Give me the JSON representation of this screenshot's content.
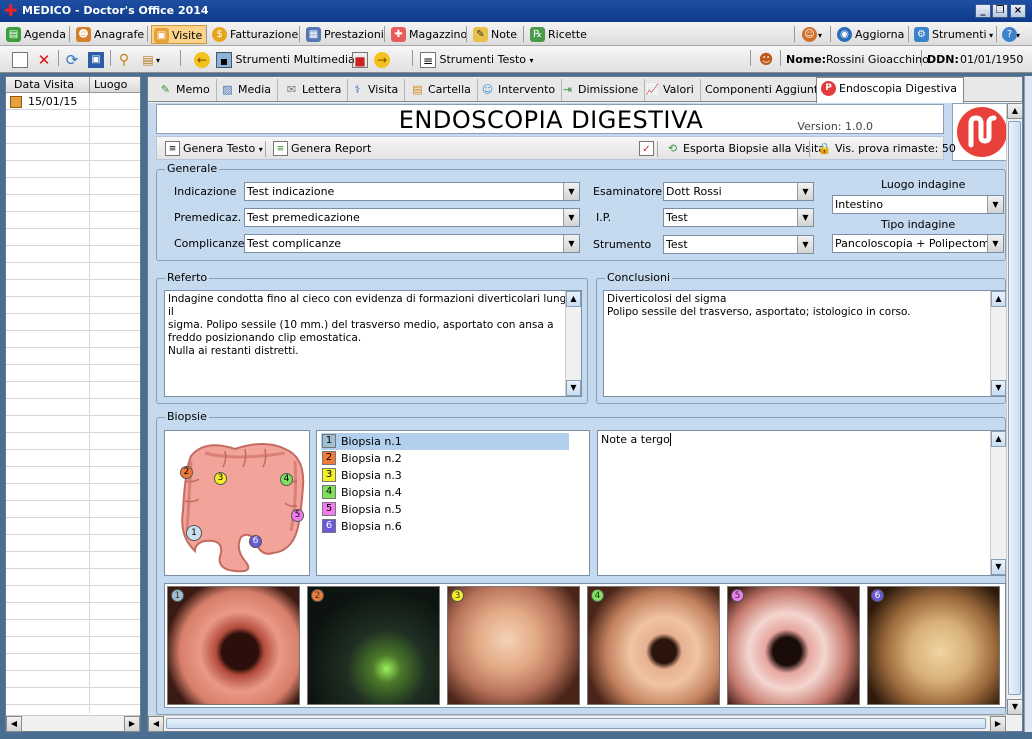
{
  "window": {
    "title": "MEDICO - Doctor's Office 2014"
  },
  "menu": {
    "agenda": "Agenda",
    "anagrafe": "Anagrafe",
    "visite": "Visite",
    "fatturazione": "Fatturazione",
    "prestazioni": "Prestazioni",
    "magazzino": "Magazzino",
    "note": "Note",
    "ricette": "Ricette",
    "aggiorna": "Aggiorna",
    "strumenti": "Strumenti"
  },
  "toolbar": {
    "multimedia": "Strumenti Multimedia",
    "testo": "Strumenti Testo",
    "nome_label": "Nome:",
    "nome_value": "Rossini Gioacchino",
    "ddn_label": "DDN:",
    "ddn_value": "01/01/1950"
  },
  "left_grid": {
    "col_date": "Data Visita",
    "col_luogo": "Luogo",
    "rows": [
      {
        "date": "15/01/15",
        "luogo": ""
      }
    ]
  },
  "tabs": [
    "Memo",
    "Media",
    "Lettera",
    "Visita",
    "Cartella",
    "Intervento",
    "Dimissione",
    "Valori",
    "Componenti Aggiuntivi",
    "Endoscopia Digestiva"
  ],
  "header": {
    "title": "ENDOSCOPIA DIGESTIVA",
    "version": "Version: 1.0.0"
  },
  "subbar": {
    "genera_testo": "Genera Testo",
    "genera_report": "Genera Report",
    "esporta": "Esporta Biopsie alla Visita",
    "vis_prova": "Vis. prova rimaste: 50"
  },
  "generale": {
    "title": "Generale",
    "indicazione_label": "Indicazione",
    "indicazione_value": "Test indicazione",
    "premed_label": "Premedicaz.",
    "premed_value": "Test premedicazione",
    "complicanze_label": "Complicanze",
    "complicanze_value": "Test complicanze",
    "esaminatore_label": "Esaminatore",
    "esaminatore_value": "Dott Rossi",
    "ip_label": "I.P.",
    "ip_value": "Test",
    "strumento_label": "Strumento",
    "strumento_value": "Test",
    "luogo_label": "Luogo indagine",
    "luogo_value": "Intestino",
    "tipo_label": "Tipo indagine",
    "tipo_value": "Pancoloscopia + Polipectomia"
  },
  "referto": {
    "title": "Referto",
    "text": "Indagine condotta fino al cieco con evidenza di formazioni diverticolari lungo il\nsigma. Polipo sessile (10 mm.) del trasverso medio, asportato con ansa a\nfreddo posizionando clip emostatica.\nNulla ai restanti distretti."
  },
  "conclusioni": {
    "title": "Conclusioni",
    "text": "Diverticolosi del sigma\nPolipo sessile del trasverso, asportato; istologico in corso."
  },
  "biopsie": {
    "title": "Biopsie",
    "items": [
      {
        "num": "1",
        "label": "Biopsia n.1",
        "color": "#9fbfd4"
      },
      {
        "num": "2",
        "label": "Biopsia n.2",
        "color": "#f07a3a"
      },
      {
        "num": "3",
        "label": "Biopsia n.3",
        "color": "#f5f021"
      },
      {
        "num": "4",
        "label": "Biopsia n.4",
        "color": "#7fe05a"
      },
      {
        "num": "5",
        "label": "Biopsia n.5",
        "color": "#f07ef0"
      },
      {
        "num": "6",
        "label": "Biopsia n.6",
        "color": "#6a5ad8"
      }
    ],
    "note": "Note a tergo"
  }
}
